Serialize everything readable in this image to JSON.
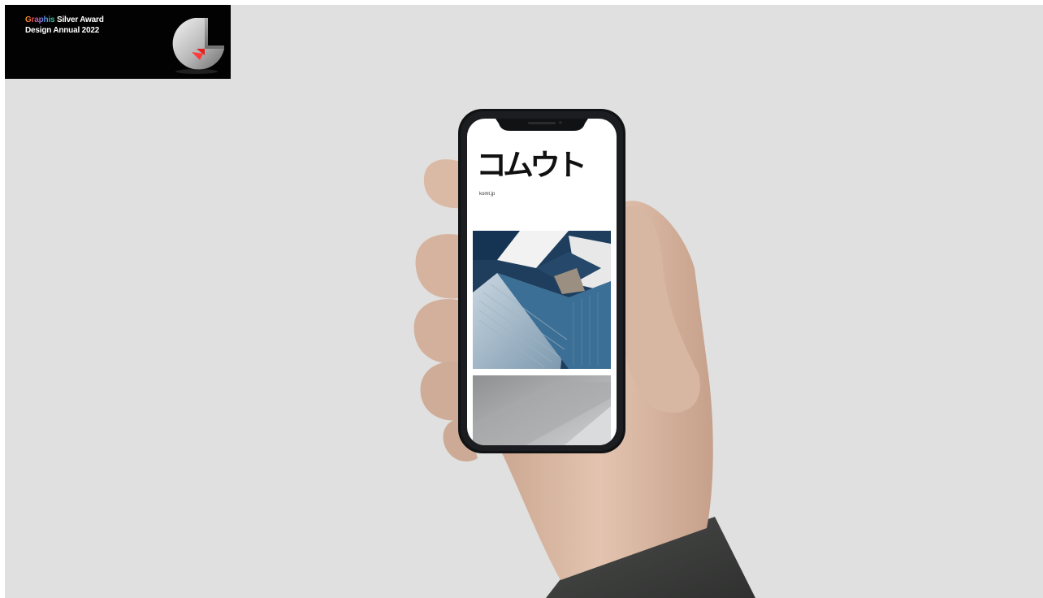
{
  "badge": {
    "graphis_word": "Graphis",
    "award_rest": " Silver Award",
    "line2": "Design Annual 2022"
  },
  "phone": {
    "logo_text": "コムウト",
    "url_text": "komt.jp"
  },
  "colors": {
    "background": "#e0e0e0",
    "badge_background": "#020202",
    "sleeve": "#3d3f3d",
    "skin": "#d9b8a3",
    "roof_blue": "#2f5f86"
  },
  "icons": [
    "award-trophy-icon"
  ]
}
